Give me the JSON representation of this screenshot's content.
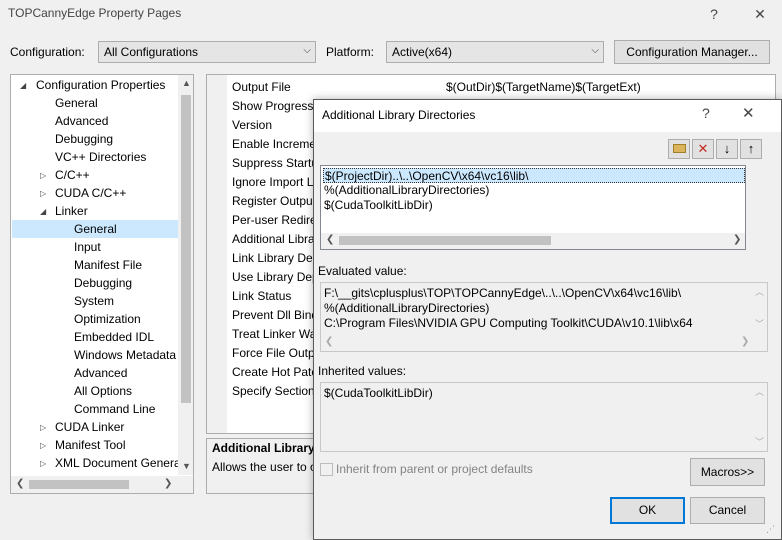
{
  "window": {
    "title": "TOPCannyEdge Property Pages",
    "help_glyph": "?",
    "close_glyph": "✕"
  },
  "toolbar": {
    "configuration_label": "Configuration:",
    "configuration_value": "All Configurations",
    "platform_label": "Platform:",
    "platform_value": "Active(x64)",
    "config_manager_label": "Configuration Manager..."
  },
  "tree": {
    "items": [
      {
        "label": "Configuration Properties"
      },
      {
        "label": "General"
      },
      {
        "label": "Advanced"
      },
      {
        "label": "Debugging"
      },
      {
        "label": "VC++ Directories"
      },
      {
        "label": "C/C++"
      },
      {
        "label": "CUDA C/C++"
      },
      {
        "label": "Linker"
      },
      {
        "label": "General"
      },
      {
        "label": "Input"
      },
      {
        "label": "Manifest File"
      },
      {
        "label": "Debugging"
      },
      {
        "label": "System"
      },
      {
        "label": "Optimization"
      },
      {
        "label": "Embedded IDL"
      },
      {
        "label": "Windows Metadata"
      },
      {
        "label": "Advanced"
      },
      {
        "label": "All Options"
      },
      {
        "label": "Command Line"
      },
      {
        "label": "CUDA Linker"
      },
      {
        "label": "Manifest Tool"
      },
      {
        "label": "XML Document Genera"
      }
    ]
  },
  "grid": {
    "rows": [
      "Output File",
      "Show Progress",
      "Version",
      "Enable Increme",
      "Suppress Startu",
      "Ignore Import L",
      "Register Output",
      "Per-user Redire",
      "Additional Libra",
      "Link Library Dep",
      "Use Library Dep",
      "Link Status",
      "Prevent Dll Bind",
      "Treat Linker Wa",
      "Force File Outpu",
      "Create Hot Patc",
      "Specify Section"
    ],
    "output_file_value": "$(OutDir)$(TargetName)$(TargetExt)",
    "desc_title": "Additional Library",
    "desc_text": "Allows the user to o"
  },
  "dialog": {
    "title": "Additional Library Directories",
    "help_glyph": "?",
    "close_glyph": "✕",
    "entries": [
      "$(ProjectDir)..\\..\\OpenCV\\x64\\vc16\\lib\\",
      "%(AdditionalLibraryDirectories)",
      "$(CudaToolkitLibDir)"
    ],
    "evaluated_label": "Evaluated value:",
    "evaluated_lines": [
      "F:\\__gits\\cplusplus\\TOP\\TOPCannyEdge\\..\\..\\OpenCV\\x64\\vc16\\lib\\",
      "%(AdditionalLibraryDirectories)",
      "C:\\Program Files\\NVIDIA GPU Computing Toolkit\\CUDA\\v10.1\\lib\\x64"
    ],
    "inherited_label": "Inherited values:",
    "inherited_lines": [
      "$(CudaToolkitLibDir)"
    ],
    "inherit_checkbox_label": "Inherit from parent or project defaults",
    "macros_label": "Macros>>",
    "ok_label": "OK",
    "cancel_label": "Cancel"
  }
}
